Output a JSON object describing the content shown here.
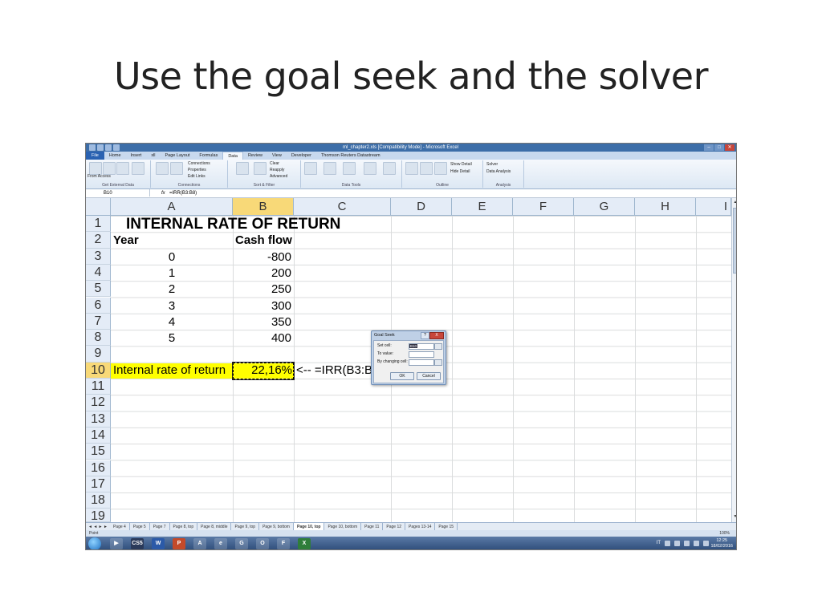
{
  "slide": {
    "title": "Use the goal seek and the solver"
  },
  "window": {
    "title": "ml_chapter2.xls [Compatibility Mode] - Microsoft Excel"
  },
  "ribbon": {
    "tabs": [
      "File",
      "Home",
      "Insert",
      "xll",
      "Page Layout",
      "Formulas",
      "Data",
      "Review",
      "View",
      "Developer",
      "Thomson Reuters Datastream"
    ],
    "active_tab": "Data",
    "groups": [
      "Get External Data",
      "Connections",
      "Sort & Filter",
      "Data Tools",
      "Outline",
      "Analysis"
    ],
    "buttons": {
      "from_access": "From Access",
      "from_web": "From Web",
      "from_text": "From Text",
      "from_other": "From Other Sources",
      "existing": "Existing Connections",
      "refresh": "Refresh All",
      "connections": "Connections",
      "properties": "Properties",
      "edit_links": "Edit Links",
      "sort": "Sort",
      "filter": "Filter",
      "clear": "Clear",
      "reapply": "Reapply",
      "advanced": "Advanced",
      "text_to_columns": "Text to Columns",
      "remove_dup": "Remove Duplicates",
      "data_validation": "Data Validation",
      "consolidate": "Consolidate",
      "what_if": "What-If Analysis",
      "group": "Group",
      "ungroup": "Ungroup",
      "subtotal": "Subtotal",
      "show_detail": "Show Detail",
      "hide_detail": "Hide Detail",
      "solver": "Solver",
      "data_analysis": "Data Analysis"
    }
  },
  "formula_bar": {
    "name_box": "B10",
    "fx": "fx",
    "formula": "=IRR(B3:B8)"
  },
  "columns": [
    "A",
    "B",
    "C",
    "D",
    "E",
    "F",
    "G",
    "H",
    "I"
  ],
  "rows": [
    "1",
    "2",
    "3",
    "4",
    "5",
    "6",
    "7",
    "8",
    "9",
    "10",
    "11",
    "12",
    "13",
    "14",
    "15",
    "16",
    "17",
    "18",
    "19"
  ],
  "sheet": {
    "title": "INTERNAL RATE OF RETURN",
    "header_year": "Year",
    "header_cash": "Cash flow",
    "years": [
      "0",
      "1",
      "2",
      "3",
      "4",
      "5"
    ],
    "cash_flows": [
      "-800",
      "200",
      "250",
      "300",
      "350",
      "400"
    ],
    "irr_label": "Internal rate of return",
    "irr_value": "22,16%",
    "irr_note": "<--  =IRR(B3:B8)"
  },
  "dialog": {
    "title": "Goal Seek",
    "help": "?",
    "close": "X",
    "set_cell_label": "Set cell:",
    "set_cell_value": "B10",
    "to_value_label": "To value:",
    "by_changing_label": "By changing cell:",
    "ok": "OK",
    "cancel": "Cancel"
  },
  "sheet_tabs": [
    "Page 4",
    "Page 5",
    "Page 7",
    "Page 8, top",
    "Page 8, middle",
    "Page 9, top",
    "Page 9, bottom",
    "Page 10, top",
    "Page 10, bottom",
    "Page 11",
    "Page 12",
    "Pages 13-14",
    "Page 15"
  ],
  "active_sheet": "Page 10, top",
  "status": {
    "mode": "Point",
    "zoom": "100%"
  },
  "taskbar": {
    "apps": [
      "CS5",
      "W",
      "P",
      "A",
      "e",
      "G",
      "O",
      "F",
      "X"
    ],
    "lang": "IT",
    "time": "12:25",
    "date": "18/02/2016"
  }
}
